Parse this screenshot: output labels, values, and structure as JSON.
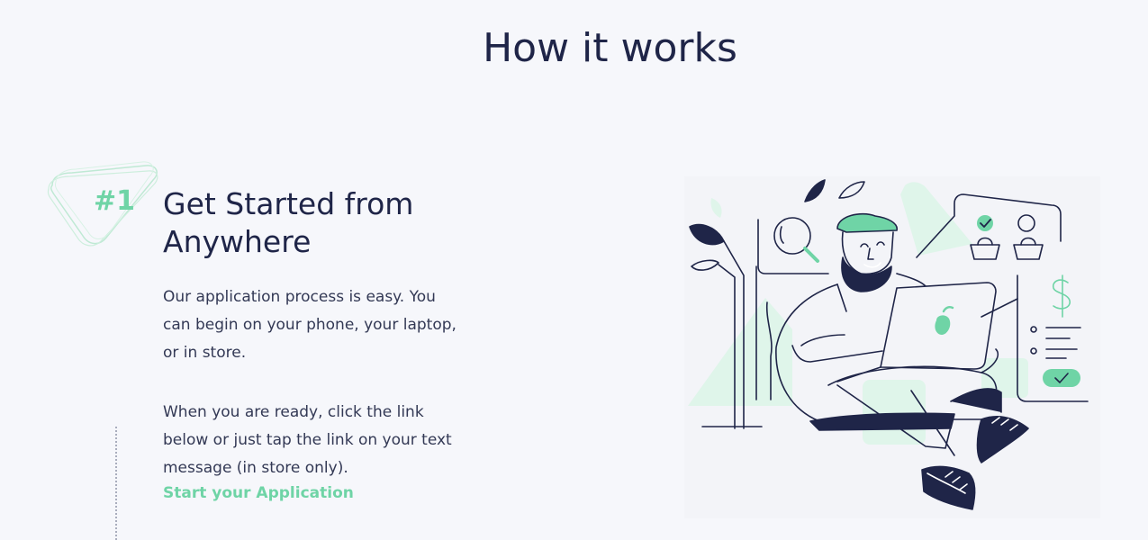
{
  "section": {
    "title": "How it works"
  },
  "step": {
    "number": "#1",
    "title": "Get Started from Anywhere",
    "paragraph_1": "Our application process is easy. You can begin on your phone, your laptop, or in store.",
    "paragraph_2": "When you are ready, click the link below or just tap the link on your text message (in store only).",
    "link_label": "Start your Application"
  },
  "illustration": {
    "name": "person-with-laptop-illustration",
    "icons": [
      "search-icon",
      "shopping-basket-icon",
      "user-icon",
      "dollar-icon",
      "check-icon",
      "leaf-icon",
      "laptop-icon"
    ]
  },
  "colors": {
    "background": "#f6f7fb",
    "heading": "#1f2548",
    "accent": "#6fd4a6",
    "accent_light": "#dff5ea",
    "body_text": "#333955"
  }
}
